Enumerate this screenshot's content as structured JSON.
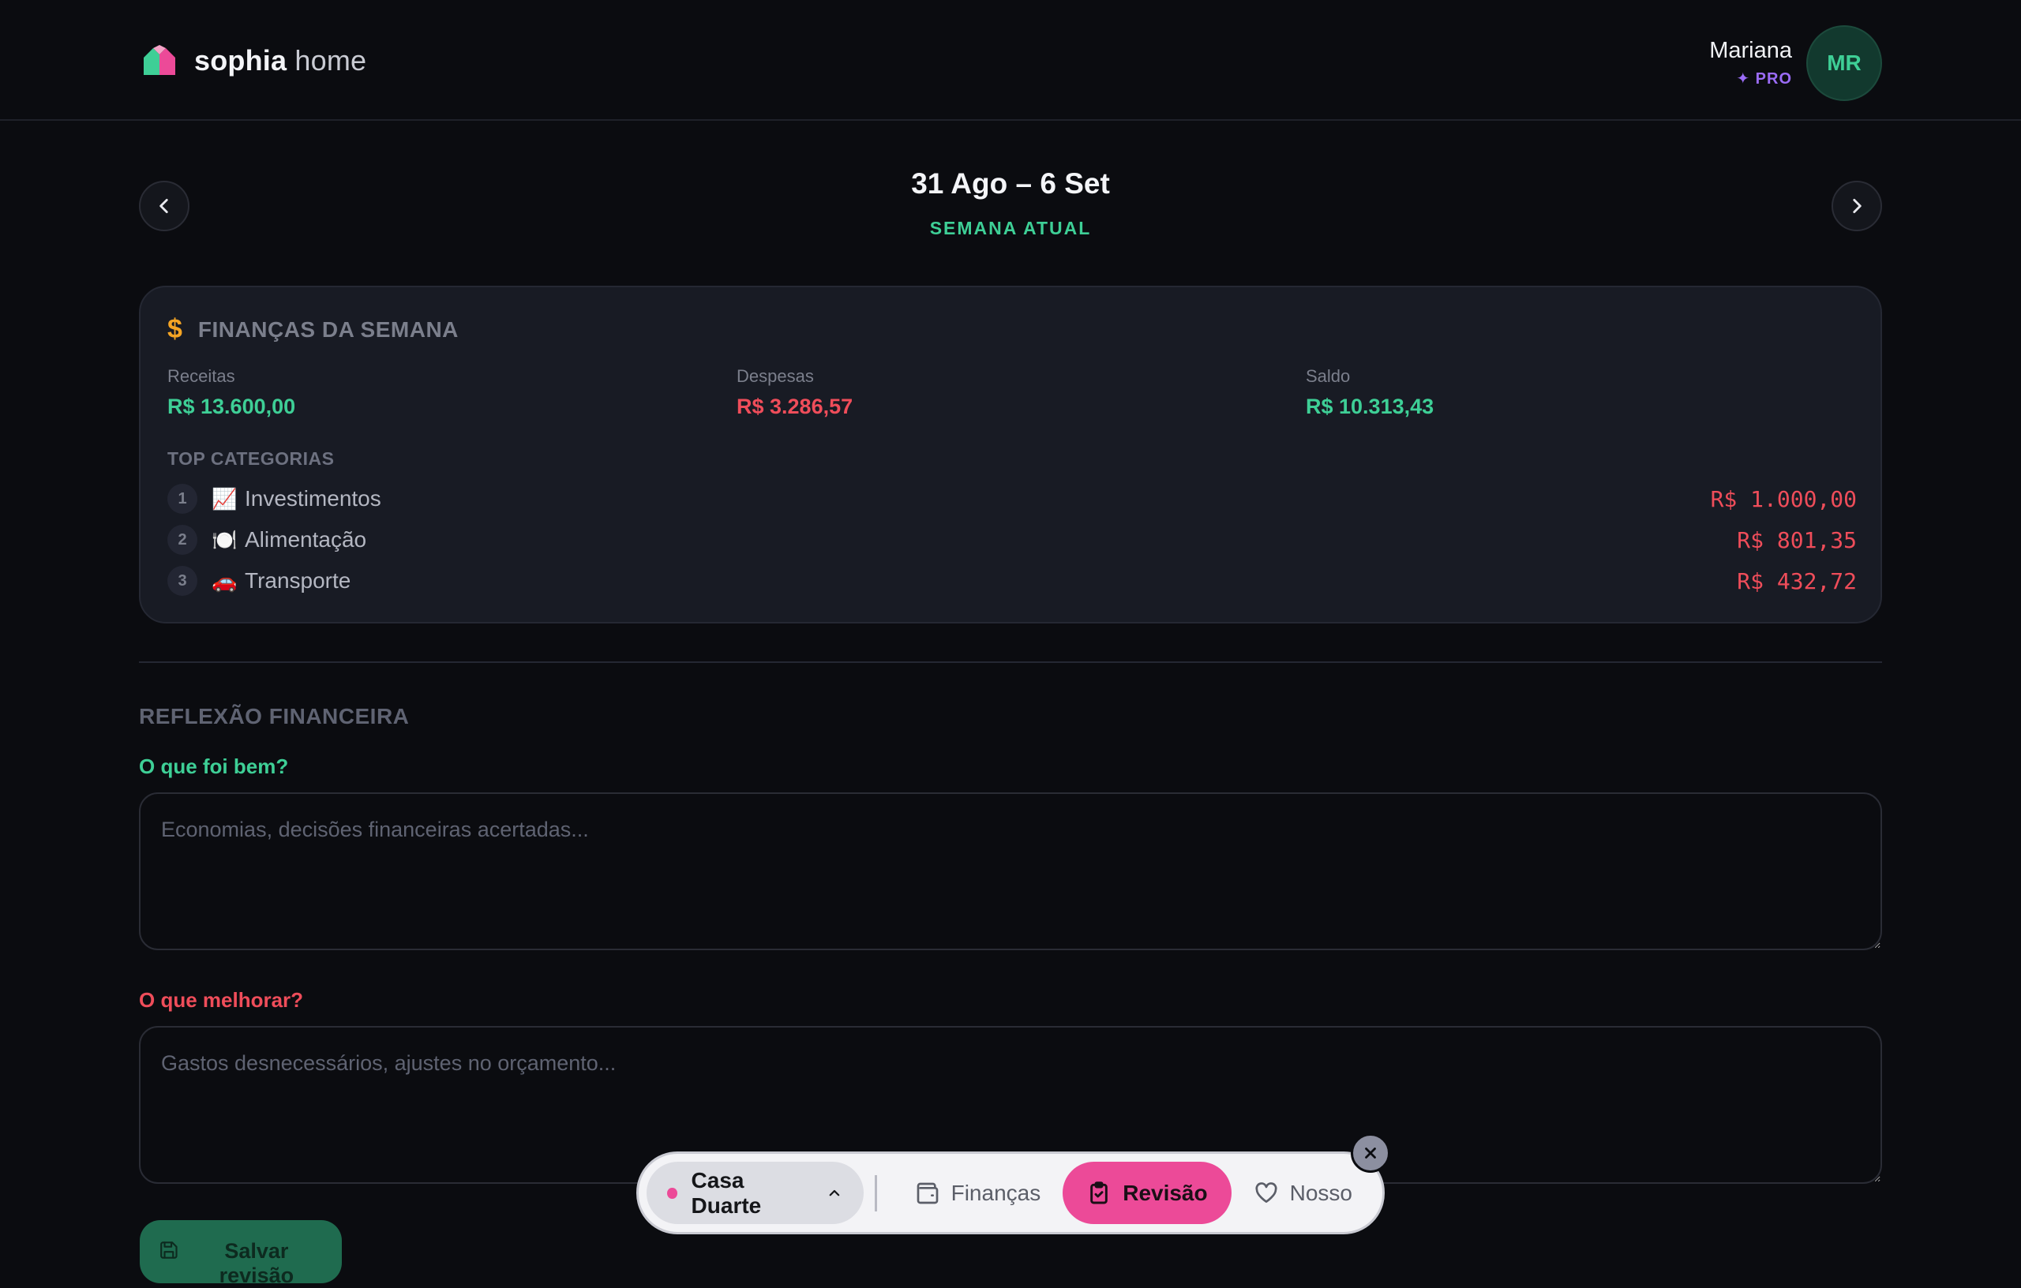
{
  "header": {
    "brand_bold": "sophia",
    "brand_light": "home",
    "user": {
      "name": "Mariana",
      "plan": "✦ PRO",
      "initials": "MR"
    }
  },
  "week": {
    "title": "31 Ago – 6 Set",
    "subtitle": "SEMANA ATUAL"
  },
  "finance": {
    "icon": "$",
    "title": "FINANÇAS DA SEMANA",
    "metrics": [
      {
        "label": "Receitas",
        "value": "R$ 13.600,00",
        "color": "#3ecf96"
      },
      {
        "label": "Despesas",
        "value": "R$ 3.286,57",
        "color": "#ef4d5a"
      },
      {
        "label": "Saldo",
        "value": "R$ 10.313,43",
        "color": "#3ecf96"
      }
    ],
    "top_title": "TOP CATEGORIAS",
    "categories": [
      {
        "rank": "1",
        "emoji": "📈",
        "name": "Investimentos",
        "value": "R$ 1.000,00"
      },
      {
        "rank": "2",
        "emoji": "🍽️",
        "name": "Alimentação",
        "value": "R$ 801,35"
      },
      {
        "rank": "3",
        "emoji": "🚗",
        "name": "Transporte",
        "value": "R$ 432,72"
      }
    ]
  },
  "reflection": {
    "title": "REFLEXÃO FINANCEIRA",
    "good_label": "O que foi bem?",
    "good_placeholder": "Economias, decisões financeiras acertadas...",
    "good_color": "#3ecf96",
    "improve_label": "O que melhorar?",
    "improve_placeholder": "Gastos desnecessários, ajustes no orçamento...",
    "improve_color": "#ef4d5a",
    "save_label": "Salvar revisão"
  },
  "dock": {
    "house": "Casa Duarte",
    "items": [
      {
        "label": "Finanças",
        "icon": "wallet-icon"
      },
      {
        "label": "Revisão",
        "icon": "clipboard-check-icon",
        "active": true
      },
      {
        "label": "Nosso",
        "icon": "heart-icon"
      }
    ]
  }
}
